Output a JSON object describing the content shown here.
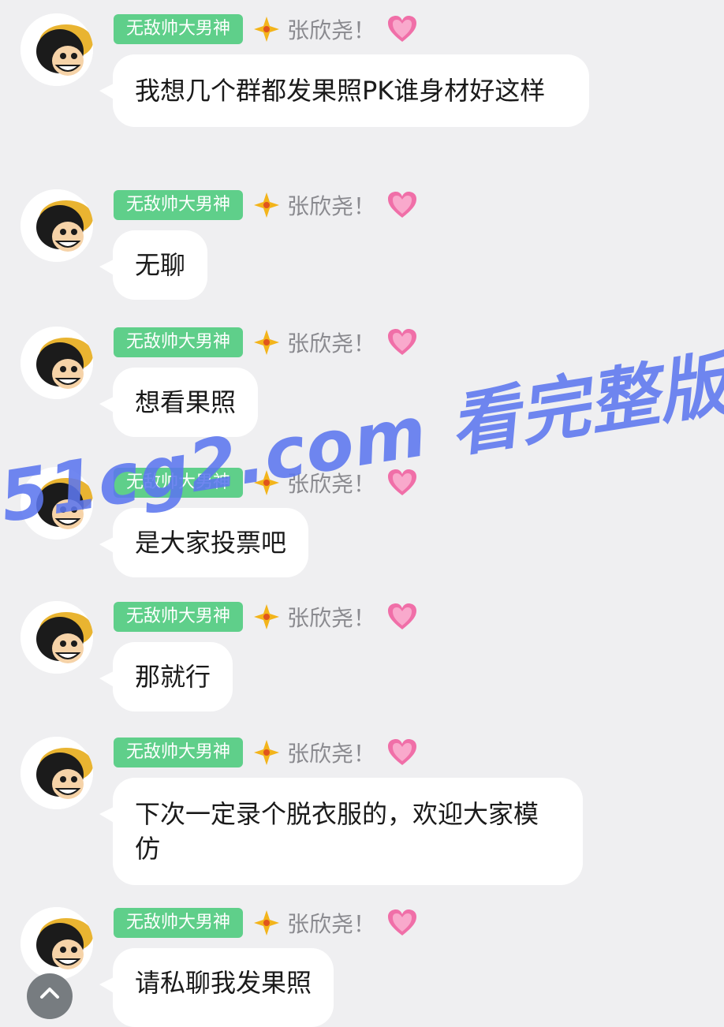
{
  "colors": {
    "background": "#efeff1",
    "badge": "#5fcf8a",
    "bubble": "#ffffff",
    "username": "#8a8a8f",
    "watermark": "#5c76ee"
  },
  "messages": [
    {
      "badge": "无敌帅大男神",
      "username": "张欣尧！",
      "text": "我想几个群都发果照PK谁身材好这样"
    },
    {
      "badge": "无敌帅大男神",
      "username": "张欣尧！",
      "text": "无聊"
    },
    {
      "badge": "无敌帅大男神",
      "username": "张欣尧！",
      "text": "想看果照"
    },
    {
      "badge": "无敌帅大男神",
      "username": "张欣尧！",
      "text": "是大家投票吧"
    },
    {
      "badge": "无敌帅大男神",
      "username": "张欣尧！",
      "text": "那就行"
    },
    {
      "badge": "无敌帅大男神",
      "username": "张欣尧！",
      "text": "下次一定录个脱衣服的，欢迎大家模仿"
    },
    {
      "badge": "无敌帅大男神",
      "username": "张欣尧！",
      "text": "请私聊我发果照"
    }
  ],
  "watermark": "51cg2.com 看完整版",
  "icons": {
    "avatar": "cartoon-straw-hat-avatar",
    "star": "sparkle-star-icon",
    "heart": "pink-heart-icon",
    "scroll": "chevron-up-icon"
  }
}
